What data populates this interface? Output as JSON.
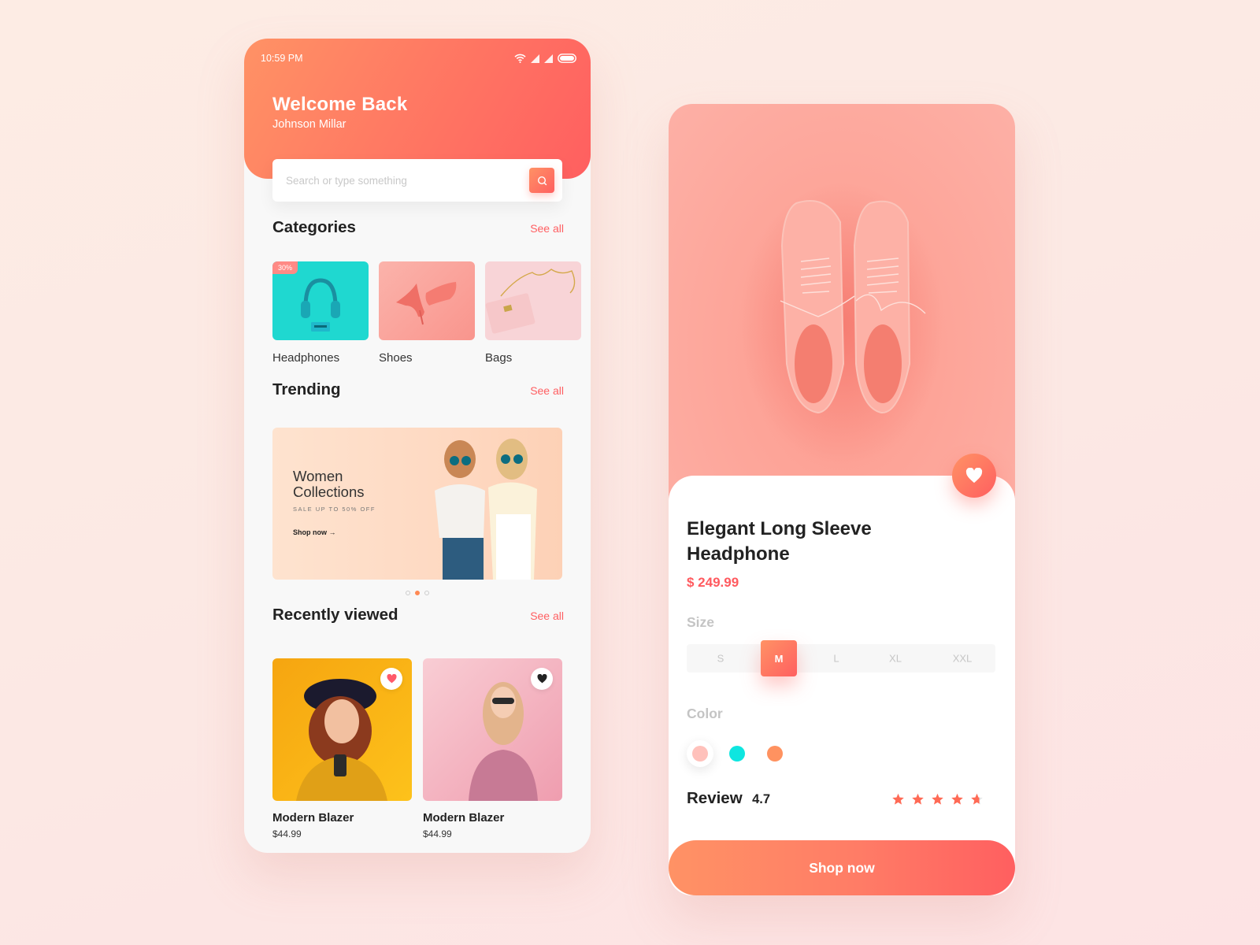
{
  "home_screen": {
    "status_bar": {
      "time": "10:59 PM",
      "icons": [
        "wifi-icon",
        "signal-icon",
        "signal-icon",
        "battery-icon"
      ]
    },
    "greeting": {
      "title": "Welcome Back",
      "user_name": "Johnson Millar"
    },
    "search": {
      "placeholder": "Search or type something",
      "value": "",
      "button_icon": "search-icon"
    },
    "categories": {
      "title": "Categories",
      "see_all": "See all",
      "items": [
        {
          "label": "Headphones",
          "badge": "30%",
          "image": "headphones-photo",
          "bg": "#1fd8d0"
        },
        {
          "label": "Shoes",
          "badge": null,
          "image": "high-heels-photo",
          "bg": "#fba8a0"
        },
        {
          "label": "Bags",
          "badge": null,
          "image": "handbag-photo",
          "bg": "#f9d6d8"
        }
      ]
    },
    "trending": {
      "title": "Trending",
      "see_all": "See all",
      "banner": {
        "title_line1": "Women",
        "title_line2": "Collections",
        "subtitle": "SALE UP TO 50% OFF",
        "cta": "Shop now →",
        "image": "two-women-sunglasses-photo"
      },
      "carousel": {
        "total": 3,
        "active_index": 1
      }
    },
    "recently_viewed": {
      "title": "Recently viewed",
      "see_all": "See all",
      "items": [
        {
          "name": "Modern Blazer",
          "price": "$44.99",
          "favorited": true,
          "image": "woman-yellow-blazer-photo",
          "bg": "#fdb913"
        },
        {
          "name": "Modern Blazer",
          "price": "$44.99",
          "favorited": false,
          "image": "woman-pink-dress-photo",
          "bg": "#f7c4cd"
        }
      ]
    }
  },
  "product_screen": {
    "hero_image": "pink-sneakers-photo",
    "favorite": true,
    "title": "Elegant Long Sleeve Headphone",
    "price": "$ 249.99",
    "size": {
      "label": "Size",
      "options": [
        "S",
        "M",
        "L",
        "XL",
        "XXL"
      ],
      "selected": "M"
    },
    "color": {
      "label": "Color",
      "options": [
        "#ffc1bb",
        "#0ee6e0",
        "#ff9260"
      ],
      "selected_index": 0
    },
    "review": {
      "label": "Review",
      "score": "4.7",
      "stars": 4.7,
      "max_stars": 5,
      "star_color": "#ff6a55"
    },
    "cta": "Shop now"
  },
  "theme": {
    "accent_start": "#ff9265",
    "accent_end": "#ff5f60",
    "link_color": "#ff5f62"
  }
}
